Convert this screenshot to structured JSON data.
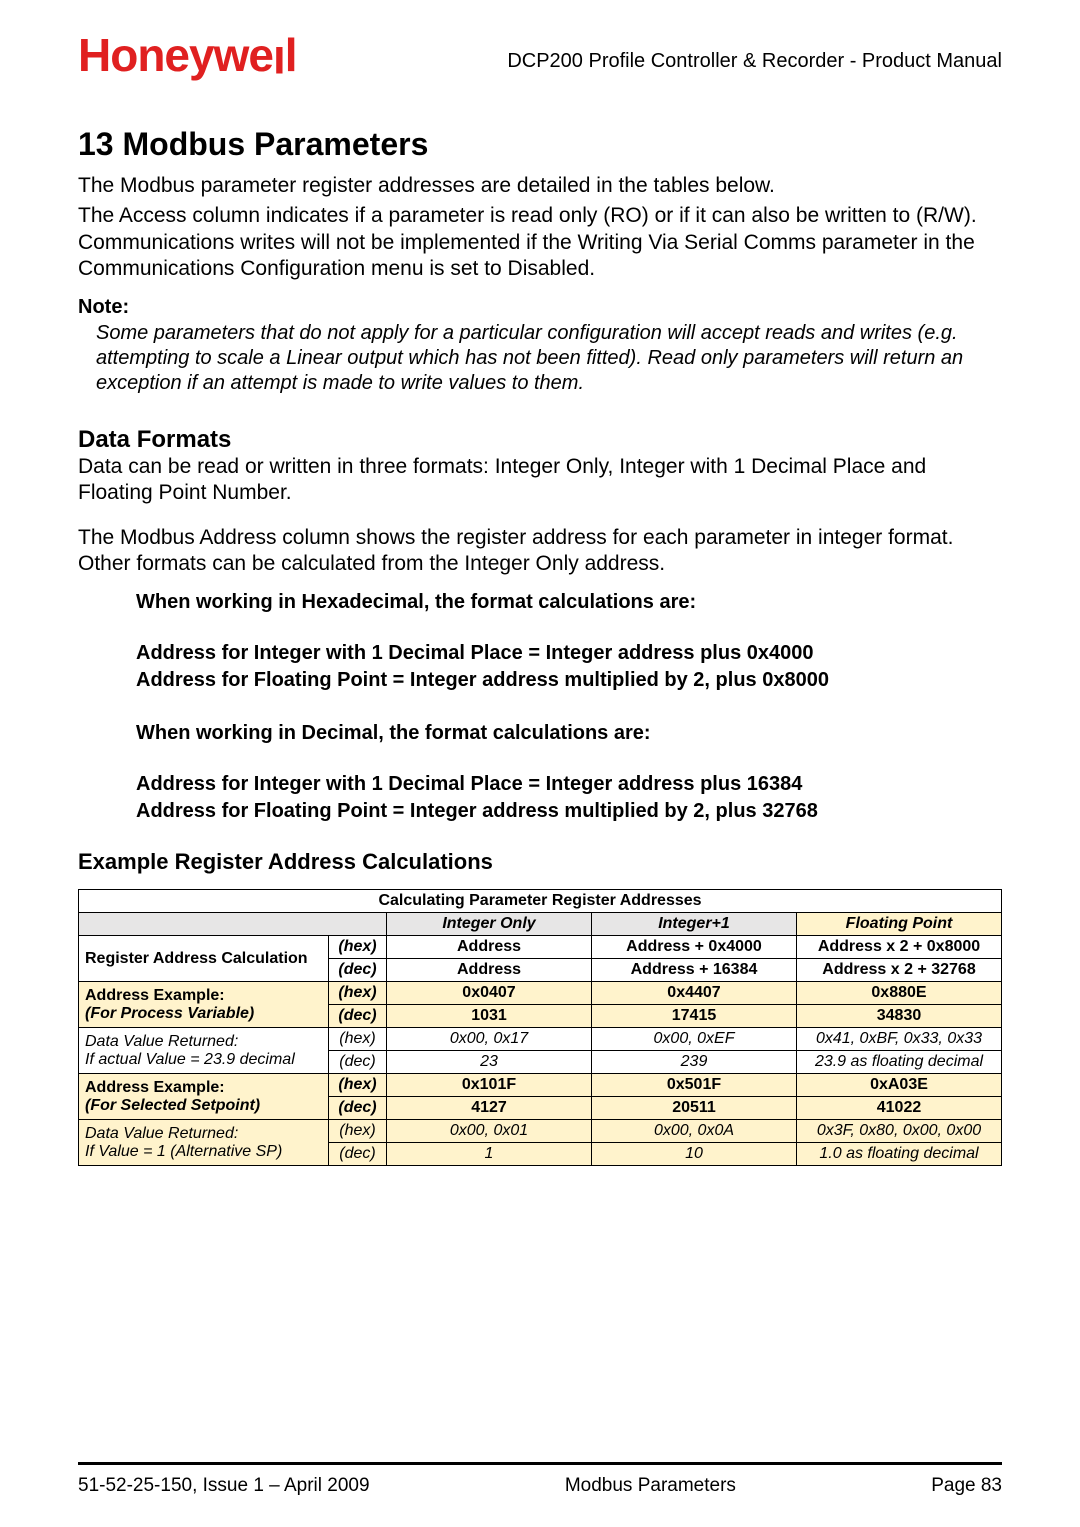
{
  "header": {
    "brand_prefix": "Honeywe",
    "brand_suffix_short": "l",
    "brand_suffix_tall": "l",
    "doc_title": "DCP200 Profile Controller & Recorder - Product Manual"
  },
  "section": {
    "title": "13 Modbus Parameters",
    "intro1": "The Modbus parameter register addresses are detailed in the tables below.",
    "intro2": "The Access column indicates if a parameter is read only (RO) or if it can also be written to (R/W). Communications writes will not be implemented if the Writing Via Serial Comms parameter in the Communications Configuration menu is set to Disabled.",
    "note_label": "Note:",
    "note_body": "Some parameters that do not apply for a particular configuration will accept reads and writes (e.g. attempting to scale a Linear output which has not been fitted). Read only parameters will return an exception if an attempt is made to write values to them."
  },
  "formats": {
    "heading": "Data Formats",
    "p1": "Data can be read or written in three formats: Integer Only, Integer with 1 Decimal Place and Floating Point Number.",
    "p2": "The Modbus Address column shows the register address for each parameter in integer format. Other formats can be calculated from the Integer Only address.",
    "hex_heading": "When working in Hexadecimal, the format calculations are:",
    "hex_line1": "Address for Integer with 1 Decimal Place = Integer address plus 0x4000",
    "hex_line2": "Address for Floating Point = Integer address multiplied by 2, plus 0x8000",
    "dec_heading": "When working in Decimal, the format calculations are:",
    "dec_line1": "Address for Integer with 1 Decimal Place = Integer address plus 16384",
    "dec_line2": "Address for Floating Point = Integer address multiplied by 2, plus 32768"
  },
  "example": {
    "heading": "Example Register Address Calculations"
  },
  "chart_data": {
    "type": "table",
    "title": "Calculating Parameter Register Addresses",
    "column_group_headers": [
      "Integer Only",
      "Integer+1",
      "Floating Point"
    ],
    "rows": [
      {
        "label": "Register Address Calculation",
        "hex": {
          "int_only": "Address",
          "int_plus1": "Address + 0x4000",
          "float": "Address x 2 + 0x8000"
        },
        "dec": {
          "int_only": "Address",
          "int_plus1": "Address + 16384",
          "float": "Address x 2 + 32768"
        },
        "highlight": false
      },
      {
        "label": "Address Example:",
        "sublabel": "(For Process Variable)",
        "hex": {
          "int_only": "0x0407",
          "int_plus1": "0x4407",
          "float": "0x880E"
        },
        "dec": {
          "int_only": "1031",
          "int_plus1": "17415",
          "float": "34830"
        },
        "highlight": true
      },
      {
        "label": "Data Value Returned:",
        "sublabel": "If actual Value = 23.9 decimal",
        "hex": {
          "int_only": "0x00, 0x17",
          "int_plus1": "0x00, 0xEF",
          "float": "0x41, 0xBF, 0x33, 0x33"
        },
        "dec": {
          "int_only": "23",
          "int_plus1": "239",
          "float": "23.9 as floating decimal"
        },
        "highlight": false
      },
      {
        "label": "Address Example:",
        "sublabel": "(For Selected Setpoint)",
        "hex": {
          "int_only": "0x101F",
          "int_plus1": "0x501F",
          "float": "0xA03E"
        },
        "dec": {
          "int_only": "4127",
          "int_plus1": "20511",
          "float": "41022"
        },
        "highlight": true
      },
      {
        "label": "Data Value Returned:",
        "sublabel": "If Value = 1 (Alternative SP)",
        "hex": {
          "int_only": "0x00, 0x01",
          "int_plus1": "0x00, 0x0A",
          "float": "0x3F, 0x80, 0x00, 0x00"
        },
        "dec": {
          "int_only": "1",
          "int_plus1": "10",
          "float": "1.0 as floating decimal"
        },
        "highlight": true
      }
    ],
    "unit_labels": {
      "hex": "(hex)",
      "dec": "(dec)"
    }
  },
  "footer": {
    "left": "51-52-25-150, Issue 1 – April 2009",
    "center": "Modbus Parameters",
    "right": "Page 83"
  }
}
